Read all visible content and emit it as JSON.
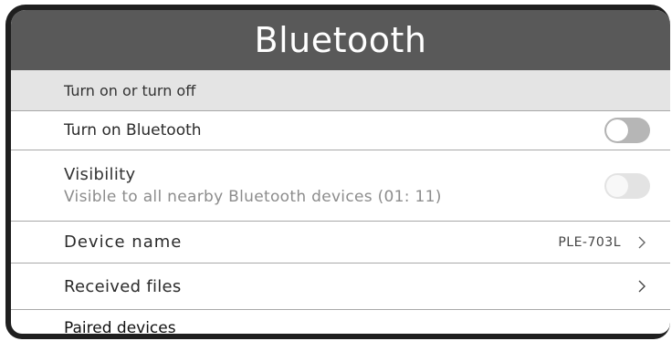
{
  "header": {
    "title": "Bluetooth"
  },
  "section": {
    "label": "Turn on or turn off"
  },
  "bluetooth_row": {
    "label": "Turn on Bluetooth",
    "toggle_state": "off"
  },
  "visibility_row": {
    "title": "Visibility",
    "subtitle": "Visible to all nearby Bluetooth devices  (01:  11)",
    "toggle_state": "off-disabled"
  },
  "device_name_row": {
    "label": "Device  name",
    "value": "PLE-703L",
    "icon": "chevron-right-icon"
  },
  "received_files_row": {
    "label": "Received files",
    "icon": "chevron-right-icon"
  },
  "paired_row": {
    "label": "Paired devices"
  },
  "colors": {
    "title_bar": "#595959",
    "section_bg": "#e4e4e4",
    "frame": "#1f1f1f",
    "toggle_off": "#b6b6b6",
    "toggle_disabled": "#e3e3e3"
  }
}
